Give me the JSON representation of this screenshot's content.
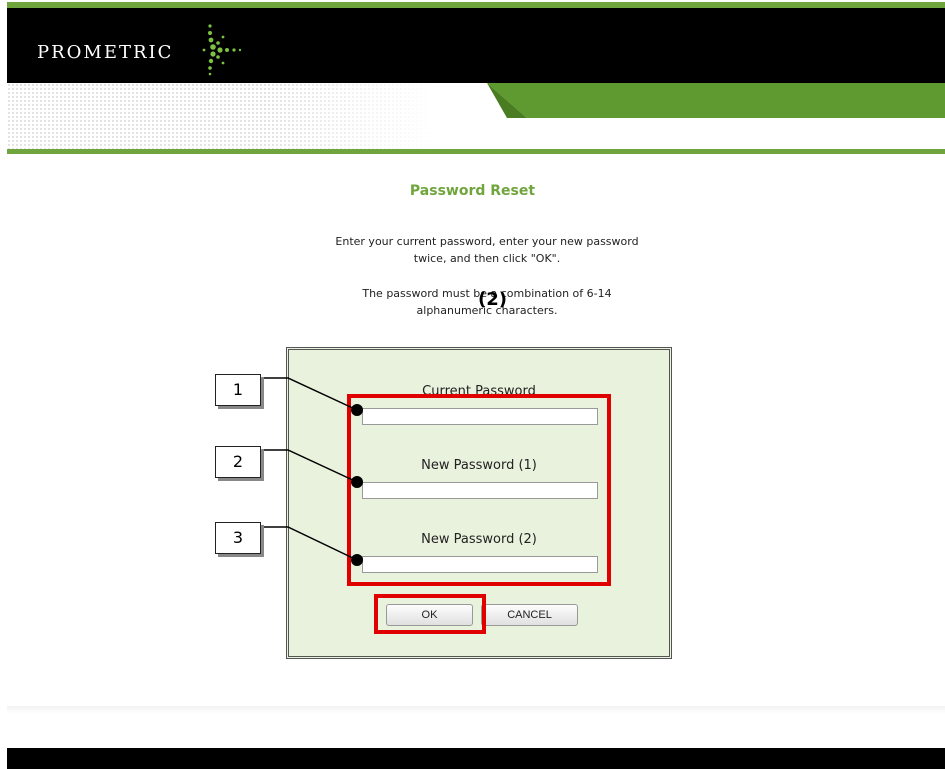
{
  "header": {
    "logo_text": "PROMETRIC",
    "brand_color": "#6fa53c"
  },
  "page": {
    "title": "Password Reset",
    "instruction_1": "Enter your current password, enter your new password twice, and then click \"OK\".",
    "instruction_2": "The password must be a combination of 6-14 alphanumeric characters."
  },
  "form": {
    "current_label": "Current Password",
    "current_value": "",
    "new1_label": "New Password (1)",
    "new1_value": "",
    "new2_label": "New Password (2)",
    "new2_value": "",
    "ok_label": "OK",
    "cancel_label": "CANCEL"
  },
  "annotations": {
    "step_label": "(2)",
    "callouts": [
      "1",
      "2",
      "3"
    ],
    "highlight_color": "#e00000"
  }
}
